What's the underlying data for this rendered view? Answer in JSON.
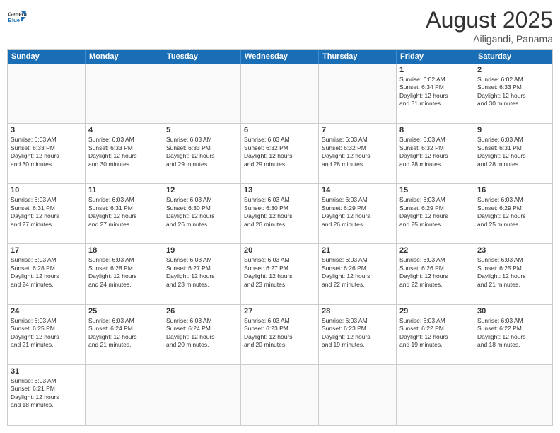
{
  "header": {
    "logo_general": "General",
    "logo_blue": "Blue",
    "month_year": "August 2025",
    "location": "Ailigandi, Panama"
  },
  "day_headers": [
    "Sunday",
    "Monday",
    "Tuesday",
    "Wednesday",
    "Thursday",
    "Friday",
    "Saturday"
  ],
  "cells": [
    {
      "day": "",
      "info": ""
    },
    {
      "day": "",
      "info": ""
    },
    {
      "day": "",
      "info": ""
    },
    {
      "day": "",
      "info": ""
    },
    {
      "day": "",
      "info": ""
    },
    {
      "day": "1",
      "info": "Sunrise: 6:02 AM\nSunset: 6:34 PM\nDaylight: 12 hours\nand 31 minutes."
    },
    {
      "day": "2",
      "info": "Sunrise: 6:02 AM\nSunset: 6:33 PM\nDaylight: 12 hours\nand 30 minutes."
    },
    {
      "day": "3",
      "info": "Sunrise: 6:03 AM\nSunset: 6:33 PM\nDaylight: 12 hours\nand 30 minutes."
    },
    {
      "day": "4",
      "info": "Sunrise: 6:03 AM\nSunset: 6:33 PM\nDaylight: 12 hours\nand 30 minutes."
    },
    {
      "day": "5",
      "info": "Sunrise: 6:03 AM\nSunset: 6:33 PM\nDaylight: 12 hours\nand 29 minutes."
    },
    {
      "day": "6",
      "info": "Sunrise: 6:03 AM\nSunset: 6:32 PM\nDaylight: 12 hours\nand 29 minutes."
    },
    {
      "day": "7",
      "info": "Sunrise: 6:03 AM\nSunset: 6:32 PM\nDaylight: 12 hours\nand 28 minutes."
    },
    {
      "day": "8",
      "info": "Sunrise: 6:03 AM\nSunset: 6:32 PM\nDaylight: 12 hours\nand 28 minutes."
    },
    {
      "day": "9",
      "info": "Sunrise: 6:03 AM\nSunset: 6:31 PM\nDaylight: 12 hours\nand 28 minutes."
    },
    {
      "day": "10",
      "info": "Sunrise: 6:03 AM\nSunset: 6:31 PM\nDaylight: 12 hours\nand 27 minutes."
    },
    {
      "day": "11",
      "info": "Sunrise: 6:03 AM\nSunset: 6:31 PM\nDaylight: 12 hours\nand 27 minutes."
    },
    {
      "day": "12",
      "info": "Sunrise: 6:03 AM\nSunset: 6:30 PM\nDaylight: 12 hours\nand 26 minutes."
    },
    {
      "day": "13",
      "info": "Sunrise: 6:03 AM\nSunset: 6:30 PM\nDaylight: 12 hours\nand 26 minutes."
    },
    {
      "day": "14",
      "info": "Sunrise: 6:03 AM\nSunset: 6:29 PM\nDaylight: 12 hours\nand 26 minutes."
    },
    {
      "day": "15",
      "info": "Sunrise: 6:03 AM\nSunset: 6:29 PM\nDaylight: 12 hours\nand 25 minutes."
    },
    {
      "day": "16",
      "info": "Sunrise: 6:03 AM\nSunset: 6:29 PM\nDaylight: 12 hours\nand 25 minutes."
    },
    {
      "day": "17",
      "info": "Sunrise: 6:03 AM\nSunset: 6:28 PM\nDaylight: 12 hours\nand 24 minutes."
    },
    {
      "day": "18",
      "info": "Sunrise: 6:03 AM\nSunset: 6:28 PM\nDaylight: 12 hours\nand 24 minutes."
    },
    {
      "day": "19",
      "info": "Sunrise: 6:03 AM\nSunset: 6:27 PM\nDaylight: 12 hours\nand 23 minutes."
    },
    {
      "day": "20",
      "info": "Sunrise: 6:03 AM\nSunset: 6:27 PM\nDaylight: 12 hours\nand 23 minutes."
    },
    {
      "day": "21",
      "info": "Sunrise: 6:03 AM\nSunset: 6:26 PM\nDaylight: 12 hours\nand 22 minutes."
    },
    {
      "day": "22",
      "info": "Sunrise: 6:03 AM\nSunset: 6:26 PM\nDaylight: 12 hours\nand 22 minutes."
    },
    {
      "day": "23",
      "info": "Sunrise: 6:03 AM\nSunset: 6:25 PM\nDaylight: 12 hours\nand 21 minutes."
    },
    {
      "day": "24",
      "info": "Sunrise: 6:03 AM\nSunset: 6:25 PM\nDaylight: 12 hours\nand 21 minutes."
    },
    {
      "day": "25",
      "info": "Sunrise: 6:03 AM\nSunset: 6:24 PM\nDaylight: 12 hours\nand 21 minutes."
    },
    {
      "day": "26",
      "info": "Sunrise: 6:03 AM\nSunset: 6:24 PM\nDaylight: 12 hours\nand 20 minutes."
    },
    {
      "day": "27",
      "info": "Sunrise: 6:03 AM\nSunset: 6:23 PM\nDaylight: 12 hours\nand 20 minutes."
    },
    {
      "day": "28",
      "info": "Sunrise: 6:03 AM\nSunset: 6:23 PM\nDaylight: 12 hours\nand 19 minutes."
    },
    {
      "day": "29",
      "info": "Sunrise: 6:03 AM\nSunset: 6:22 PM\nDaylight: 12 hours\nand 19 minutes."
    },
    {
      "day": "30",
      "info": "Sunrise: 6:03 AM\nSunset: 6:22 PM\nDaylight: 12 hours\nand 18 minutes."
    },
    {
      "day": "31",
      "info": "Sunrise: 6:03 AM\nSunset: 6:21 PM\nDaylight: 12 hours\nand 18 minutes."
    },
    {
      "day": "",
      "info": ""
    },
    {
      "day": "",
      "info": ""
    },
    {
      "day": "",
      "info": ""
    },
    {
      "day": "",
      "info": ""
    },
    {
      "day": "",
      "info": ""
    },
    {
      "day": "",
      "info": ""
    }
  ]
}
